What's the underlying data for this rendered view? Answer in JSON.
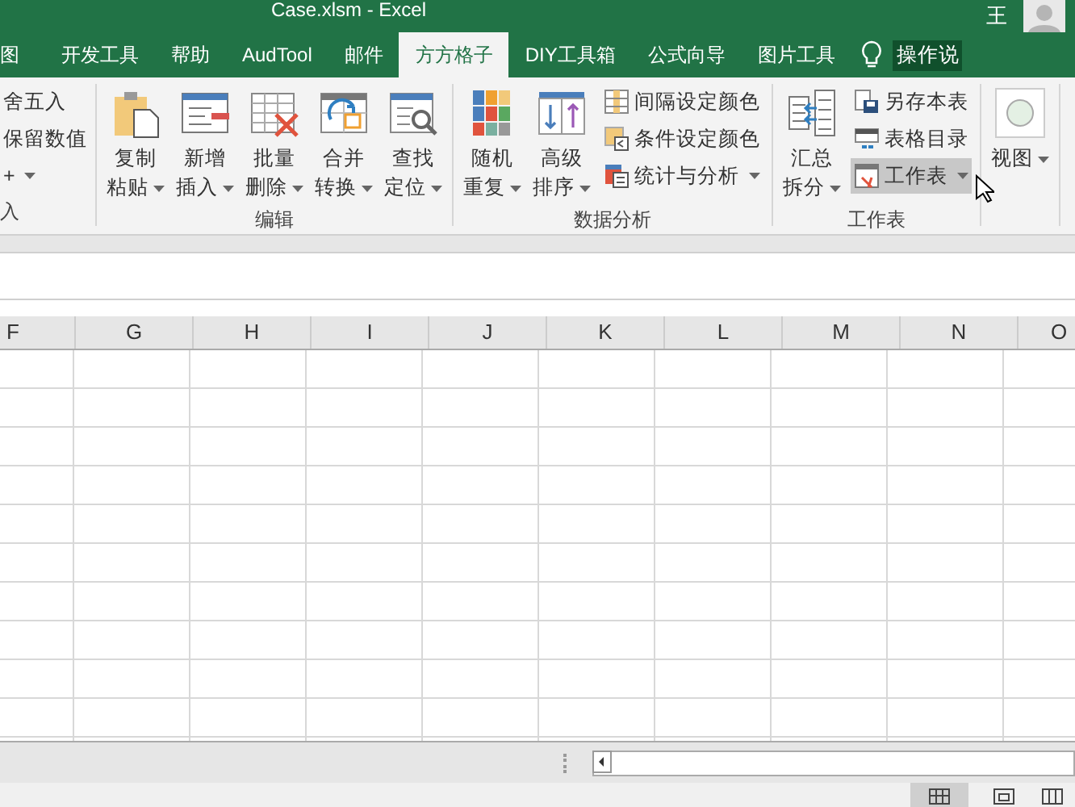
{
  "window": {
    "title": "Case.xlsm  -  Excel",
    "user": "王"
  },
  "tabs": [
    {
      "label": "图",
      "selected": false
    },
    {
      "label": "开发工具",
      "selected": false
    },
    {
      "label": "帮助",
      "selected": false
    },
    {
      "label": "AudTool",
      "selected": false
    },
    {
      "label": "邮件",
      "selected": false
    },
    {
      "label": "方方格子",
      "selected": true
    },
    {
      "label": "DIY工具箱",
      "selected": false
    },
    {
      "label": "公式向导",
      "selected": false
    },
    {
      "label": "图片工具",
      "selected": false
    }
  ],
  "tell_me": "操作说",
  "ribbon": {
    "groups": [
      {
        "label": "入",
        "items": [
          {
            "kind": "text",
            "label": "舍五入",
            "dropdown": false,
            "hovered": false
          },
          {
            "kind": "text",
            "label": "保留数值",
            "dropdown": false,
            "hovered": false
          },
          {
            "kind": "text",
            "label": "+",
            "dropdown": true,
            "hovered": false
          }
        ]
      },
      {
        "label": "编辑",
        "items": [
          {
            "kind": "large",
            "label": "复制粘贴",
            "dropdown": true,
            "hovered": false
          },
          {
            "kind": "large",
            "label": "新增插入",
            "dropdown": true,
            "hovered": false
          },
          {
            "kind": "large",
            "label": "批量删除",
            "dropdown": true,
            "hovered": false
          },
          {
            "kind": "large",
            "label": "合并转换",
            "dropdown": true,
            "hovered": false
          },
          {
            "kind": "large",
            "label": "查找定位",
            "dropdown": true,
            "hovered": false
          }
        ]
      },
      {
        "label": "数据分析",
        "items": [
          {
            "kind": "large",
            "label": "随机重复",
            "dropdown": true,
            "hovered": false
          },
          {
            "kind": "large",
            "label": "高级排序",
            "dropdown": true,
            "hovered": false
          },
          {
            "kind": "small",
            "label": "间隔设定颜色",
            "dropdown": false,
            "hovered": false
          },
          {
            "kind": "small",
            "label": "条件设定颜色",
            "dropdown": false,
            "hovered": false
          },
          {
            "kind": "small",
            "label": "统计与分析",
            "dropdown": true,
            "hovered": false
          }
        ]
      },
      {
        "label": "工作表",
        "items": [
          {
            "kind": "large",
            "label": "汇总拆分",
            "dropdown": true,
            "hovered": false
          },
          {
            "kind": "small",
            "label": "另存本表",
            "dropdown": false,
            "hovered": false
          },
          {
            "kind": "small",
            "label": "表格目录",
            "dropdown": false,
            "hovered": false
          },
          {
            "kind": "small",
            "label": "工作表",
            "dropdown": true,
            "hovered": true
          }
        ]
      },
      {
        "items": [
          {
            "kind": "large",
            "label": "视图",
            "dropdown": true,
            "hovered": false
          }
        ]
      }
    ]
  },
  "columns": [
    "F",
    "G",
    "H",
    "I",
    "J",
    "K",
    "L",
    "M",
    "N",
    "O"
  ]
}
